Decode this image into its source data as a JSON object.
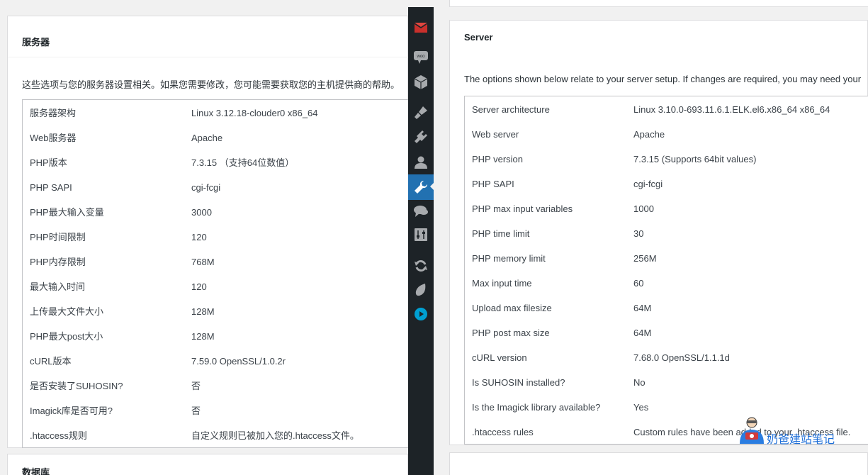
{
  "left": {
    "title": "服务器",
    "description": "这些选项与您的服务器设置相关。如果您需要修改，您可能需要获取您的主机提供商的帮助。",
    "rows": [
      {
        "key": "服务器架构",
        "value": "Linux 3.12.18-clouder0 x86_64"
      },
      {
        "key": "Web服务器",
        "value": "Apache"
      },
      {
        "key": "PHP版本",
        "value": "7.3.15 （支持64位数值）"
      },
      {
        "key": "PHP SAPI",
        "value": "cgi-fcgi"
      },
      {
        "key": "PHP最大输入变量",
        "value": "3000"
      },
      {
        "key": "PHP时间限制",
        "value": "120"
      },
      {
        "key": "PHP内存限制",
        "value": "768M"
      },
      {
        "key": "最大输入时间",
        "value": "120"
      },
      {
        "key": "上传最大文件大小",
        "value": "128M"
      },
      {
        "key": "PHP最大post大小",
        "value": "128M"
      },
      {
        "key": "cURL版本",
        "value": "7.59.0 OpenSSL/1.0.2r"
      },
      {
        "key": "是否安装了SUHOSIN?",
        "value": "否"
      },
      {
        "key": "Imagick库是否可用?",
        "value": "否"
      },
      {
        "key": ".htaccess规则",
        "value": "自定义规则已被加入您的.htaccess文件。"
      }
    ],
    "next_title": "数据库"
  },
  "right": {
    "title": "Server",
    "description": "The options shown below relate to your server setup. If changes are required, you may need your",
    "rows": [
      {
        "key": "Server architecture",
        "value": "Linux 3.10.0-693.11.6.1.ELK.el6.x86_64 x86_64"
      },
      {
        "key": "Web server",
        "value": "Apache"
      },
      {
        "key": "PHP version",
        "value": "7.3.15 (Supports 64bit values)"
      },
      {
        "key": "PHP SAPI",
        "value": "cgi-fcgi"
      },
      {
        "key": "PHP max input variables",
        "value": "1000"
      },
      {
        "key": "PHP time limit",
        "value": "30"
      },
      {
        "key": "PHP memory limit",
        "value": "256M"
      },
      {
        "key": "Max input time",
        "value": "60"
      },
      {
        "key": "Upload max filesize",
        "value": "64M"
      },
      {
        "key": "PHP post max size",
        "value": "64M"
      },
      {
        "key": "cURL version",
        "value": "7.68.0 OpenSSL/1.1.1d"
      },
      {
        "key": "Is SUHOSIN installed?",
        "value": "No"
      },
      {
        "key": "Is the Imagick library available?",
        "value": "Yes"
      },
      {
        "key": ".htaccess rules",
        "value": "Custom rules have been added to your .htaccess file."
      }
    ]
  },
  "sidebar": {
    "icons": [
      "gmail-icon",
      "woo-icon",
      "box-icon",
      "brush-icon",
      "plugin-icon",
      "user-icon",
      "wrench-icon",
      "chat-icon",
      "sliders-icon",
      "refresh-icon",
      "leaf-icon",
      "play-icon"
    ],
    "active": "wrench-icon",
    "accent": "#2271b1"
  },
  "watermark": {
    "text": "奶爸建站笔记"
  }
}
